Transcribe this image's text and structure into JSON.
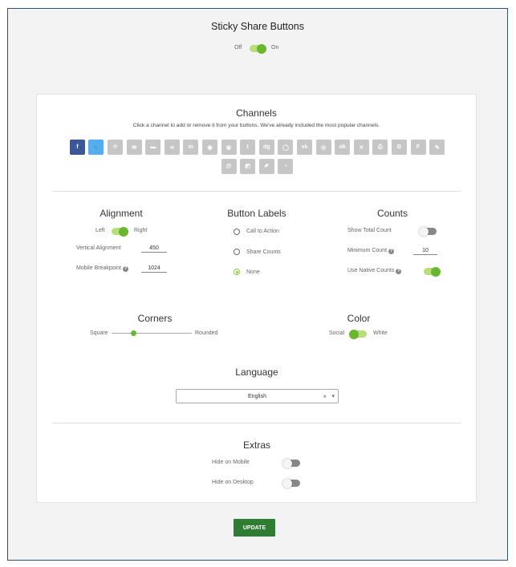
{
  "title": "Sticky Share Buttons",
  "master_toggle": {
    "off": "Off",
    "on": "On",
    "state": "on"
  },
  "channels": {
    "heading": "Channels",
    "subtitle": "Click a channel to add or remove it from your buttons. We've already included the most popular channels.",
    "row1": [
      {
        "name": "facebook-icon",
        "glyph": "f",
        "color": "#3b5998",
        "selected": true
      },
      {
        "name": "twitter-icon",
        "glyph": "🐦",
        "color": "#55acee",
        "selected": true
      },
      {
        "name": "pinterest-icon",
        "glyph": "℗",
        "color": "#c6c6c6",
        "selected": false
      },
      {
        "name": "email-icon",
        "glyph": "✉",
        "color": "#c6c6c6",
        "selected": false
      },
      {
        "name": "sms-icon",
        "glyph": "▬",
        "color": "#c6c6c6",
        "selected": false
      },
      {
        "name": "sharethis-icon",
        "glyph": "⋖",
        "color": "#c6c6c6",
        "selected": false
      },
      {
        "name": "linkedin-icon",
        "glyph": "in",
        "color": "#c6c6c6",
        "selected": false
      },
      {
        "name": "messenger-icon",
        "glyph": "◉",
        "color": "#c6c6c6",
        "selected": false
      },
      {
        "name": "reddit-icon",
        "glyph": "◍",
        "color": "#c6c6c6",
        "selected": false
      },
      {
        "name": "tumblr-icon",
        "glyph": "t",
        "color": "#c6c6c6",
        "selected": false
      },
      {
        "name": "digg-icon",
        "glyph": "dg",
        "color": "#c6c6c6",
        "selected": false
      },
      {
        "name": "whatsapp-icon",
        "glyph": "◯",
        "color": "#c6c6c6",
        "selected": false
      },
      {
        "name": "vk-icon",
        "glyph": "vk",
        "color": "#c6c6c6",
        "selected": false
      },
      {
        "name": "weibo-icon",
        "glyph": "◎",
        "color": "#c6c6c6",
        "selected": false
      },
      {
        "name": "odnoklassniki-icon",
        "glyph": "ok",
        "color": "#c6c6c6",
        "selected": false
      },
      {
        "name": "xing-icon",
        "glyph": "✕",
        "color": "#c6c6c6",
        "selected": false
      },
      {
        "name": "print-icon",
        "glyph": "⎙",
        "color": "#c6c6c6",
        "selected": false
      },
      {
        "name": "blogger-icon",
        "glyph": "B",
        "color": "#c6c6c6",
        "selected": false
      },
      {
        "name": "flipboard-icon",
        "glyph": "F",
        "color": "#c6c6c6",
        "selected": false
      },
      {
        "name": "meneame-icon",
        "glyph": "✎",
        "color": "#c6c6c6",
        "selected": false
      }
    ],
    "row2": [
      {
        "name": "mailru-icon",
        "glyph": "@",
        "color": "#c6c6c6",
        "selected": false
      },
      {
        "name": "delicious-icon",
        "glyph": "◩",
        "color": "#c6c6c6",
        "selected": false
      },
      {
        "name": "livejournal-icon",
        "glyph": "✐",
        "color": "#c6c6c6",
        "selected": false
      },
      {
        "name": "wechat-icon",
        "glyph": "◔",
        "color": "#c6c6c6",
        "selected": false
      }
    ]
  },
  "alignment": {
    "heading": "Alignment",
    "left": "Left",
    "right": "Right",
    "state": "right",
    "vertical_label": "Vertical Alignment",
    "vertical_value": "450",
    "mobile_label": "Mobile Breakpoint",
    "mobile_value": "1024"
  },
  "button_labels": {
    "heading": "Button Labels",
    "options": [
      "Call to Action",
      "Share Counts",
      "None"
    ],
    "selected": "None"
  },
  "counts": {
    "heading": "Counts",
    "show_total": "Show Total Count",
    "show_total_state": "off",
    "minimum_label": "Minimum Count",
    "minimum_value": "10",
    "native_label": "Use Native Counts",
    "native_state": "on"
  },
  "corners": {
    "heading": "Corners",
    "square": "Square",
    "rounded": "Rounded",
    "level_percent": 27
  },
  "color": {
    "heading": "Color",
    "social": "Social",
    "white": "White",
    "state": "social"
  },
  "language": {
    "heading": "Language",
    "value": "English",
    "clear": "×",
    "arrow": "▾"
  },
  "extras": {
    "heading": "Extras",
    "hide_mobile": "Hide on Mobile",
    "hide_mobile_state": "off",
    "hide_desktop": "Hide on Desktop",
    "hide_desktop_state": "off"
  },
  "update_label": "UPDATE"
}
